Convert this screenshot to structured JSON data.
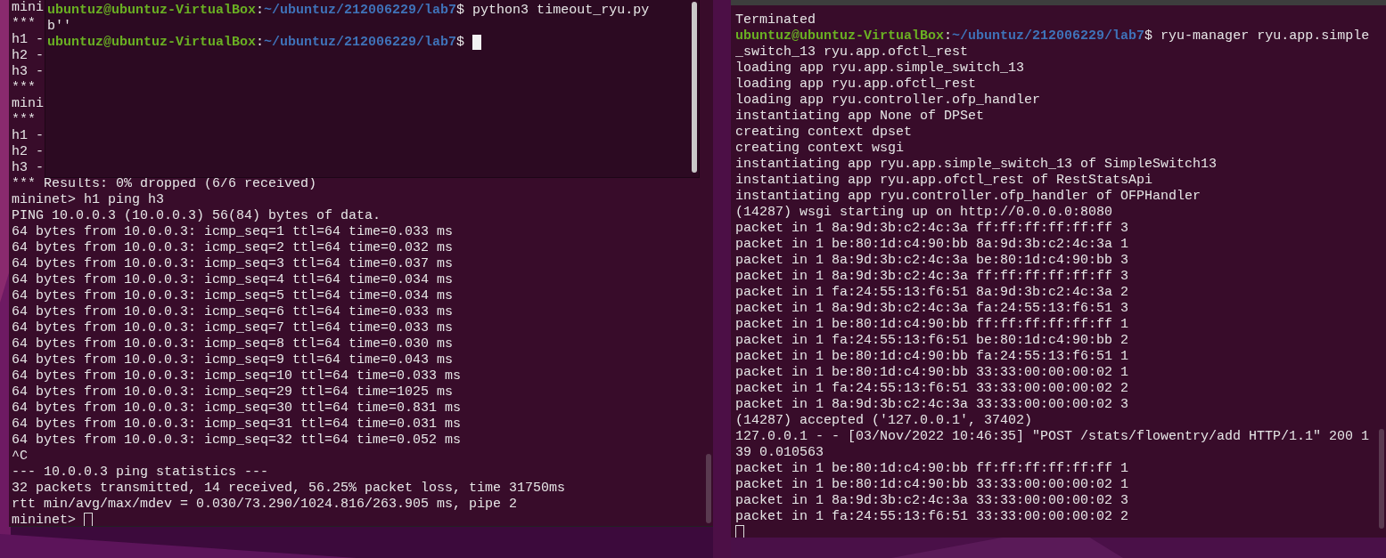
{
  "terminals": [
    {
      "lines": [
        {
          "kind": "output",
          "text": "mini"
        },
        {
          "kind": "output",
          "text": "***"
        },
        {
          "kind": "output",
          "text": "h1 -"
        },
        {
          "kind": "output",
          "text": "h2 -"
        },
        {
          "kind": "output",
          "text": "h3 -"
        },
        {
          "kind": "output",
          "text": "***"
        },
        {
          "kind": "output",
          "text": "mini"
        },
        {
          "kind": "output",
          "text": "***"
        },
        {
          "kind": "output",
          "text": "h1 -"
        },
        {
          "kind": "output",
          "text": "h2 -"
        },
        {
          "kind": "output",
          "text": "h3 -"
        },
        {
          "kind": "output",
          "text": "*** Results: 0% dropped (6/6 received)"
        },
        {
          "kind": "output",
          "text": "mininet> h1 ping h3"
        },
        {
          "kind": "output",
          "text": "PING 10.0.0.3 (10.0.0.3) 56(84) bytes of data."
        },
        {
          "kind": "output",
          "text": "64 bytes from 10.0.0.3: icmp_seq=1 ttl=64 time=0.033 ms"
        },
        {
          "kind": "output",
          "text": "64 bytes from 10.0.0.3: icmp_seq=2 ttl=64 time=0.032 ms"
        },
        {
          "kind": "output",
          "text": "64 bytes from 10.0.0.3: icmp_seq=3 ttl=64 time=0.037 ms"
        },
        {
          "kind": "output",
          "text": "64 bytes from 10.0.0.3: icmp_seq=4 ttl=64 time=0.034 ms"
        },
        {
          "kind": "output",
          "text": "64 bytes from 10.0.0.3: icmp_seq=5 ttl=64 time=0.034 ms"
        },
        {
          "kind": "output",
          "text": "64 bytes from 10.0.0.3: icmp_seq=6 ttl=64 time=0.033 ms"
        },
        {
          "kind": "output",
          "text": "64 bytes from 10.0.0.3: icmp_seq=7 ttl=64 time=0.033 ms"
        },
        {
          "kind": "output",
          "text": "64 bytes from 10.0.0.3: icmp_seq=8 ttl=64 time=0.030 ms"
        },
        {
          "kind": "output",
          "text": "64 bytes from 10.0.0.3: icmp_seq=9 ttl=64 time=0.043 ms"
        },
        {
          "kind": "output",
          "text": "64 bytes from 10.0.0.3: icmp_seq=10 ttl=64 time=0.033 ms"
        },
        {
          "kind": "output",
          "text": "64 bytes from 10.0.0.3: icmp_seq=29 ttl=64 time=1025 ms"
        },
        {
          "kind": "output",
          "text": "64 bytes from 10.0.0.3: icmp_seq=30 ttl=64 time=0.831 ms"
        },
        {
          "kind": "output",
          "text": "64 bytes from 10.0.0.3: icmp_seq=31 ttl=64 time=0.031 ms"
        },
        {
          "kind": "output",
          "text": "64 bytes from 10.0.0.3: icmp_seq=32 ttl=64 time=0.052 ms"
        },
        {
          "kind": "output",
          "text": "^C"
        },
        {
          "kind": "output",
          "text": "--- 10.0.0.3 ping statistics ---"
        },
        {
          "kind": "output",
          "text": "32 packets transmitted, 14 received, 56.25% packet loss, time 31750ms"
        },
        {
          "kind": "output",
          "text": "rtt min/avg/max/mdev = 0.030/73.290/1024.816/263.905 ms, pipe 2"
        },
        {
          "kind": "output",
          "text": "mininet> "
        }
      ],
      "cursor": {
        "focused": false,
        "own_line": false
      }
    },
    {
      "lines": [
        {
          "kind": "prompt",
          "user": "ubuntuz@ubuntuz-VirtualBox",
          "sep": ":",
          "path": "~/ubuntuz/212006229/lab7",
          "text": "$ python3 timeout_ryu.py"
        },
        {
          "kind": "output",
          "text": "b''"
        },
        {
          "kind": "prompt",
          "user": "ubuntuz@ubuntuz-VirtualBox",
          "sep": ":",
          "path": "~/ubuntuz/212006229/lab7",
          "text": "$ "
        }
      ],
      "cursor": {
        "focused": true,
        "own_line": false
      }
    },
    {
      "lines": [
        {
          "kind": "output",
          "text": "Terminated"
        },
        {
          "kind": "prompt",
          "user": "ubuntuz@ubuntuz-VirtualBox",
          "sep": ":",
          "path": "~/ubuntuz/212006229/lab7",
          "text": "$ ryu-manager ryu.app.simple"
        },
        {
          "kind": "output",
          "text": "_switch_13 ryu.app.ofctl_rest"
        },
        {
          "kind": "output",
          "text": "loading app ryu.app.simple_switch_13"
        },
        {
          "kind": "output",
          "text": "loading app ryu.app.ofctl_rest"
        },
        {
          "kind": "output",
          "text": "loading app ryu.controller.ofp_handler"
        },
        {
          "kind": "output",
          "text": "instantiating app None of DPSet"
        },
        {
          "kind": "output",
          "text": "creating context dpset"
        },
        {
          "kind": "output",
          "text": "creating context wsgi"
        },
        {
          "kind": "output",
          "text": "instantiating app ryu.app.simple_switch_13 of SimpleSwitch13"
        },
        {
          "kind": "output",
          "text": "instantiating app ryu.app.ofctl_rest of RestStatsApi"
        },
        {
          "kind": "output",
          "text": "instantiating app ryu.controller.ofp_handler of OFPHandler"
        },
        {
          "kind": "output",
          "text": "(14287) wsgi starting up on http://0.0.0.0:8080"
        },
        {
          "kind": "output",
          "text": "packet in 1 8a:9d:3b:c2:4c:3a ff:ff:ff:ff:ff:ff 3"
        },
        {
          "kind": "output",
          "text": "packet in 1 be:80:1d:c4:90:bb 8a:9d:3b:c2:4c:3a 1"
        },
        {
          "kind": "output",
          "text": "packet in 1 8a:9d:3b:c2:4c:3a be:80:1d:c4:90:bb 3"
        },
        {
          "kind": "output",
          "text": "packet in 1 8a:9d:3b:c2:4c:3a ff:ff:ff:ff:ff:ff 3"
        },
        {
          "kind": "output",
          "text": "packet in 1 fa:24:55:13:f6:51 8a:9d:3b:c2:4c:3a 2"
        },
        {
          "kind": "output",
          "text": "packet in 1 8a:9d:3b:c2:4c:3a fa:24:55:13:f6:51 3"
        },
        {
          "kind": "output",
          "text": "packet in 1 be:80:1d:c4:90:bb ff:ff:ff:ff:ff:ff 1"
        },
        {
          "kind": "output",
          "text": "packet in 1 fa:24:55:13:f6:51 be:80:1d:c4:90:bb 2"
        },
        {
          "kind": "output",
          "text": "packet in 1 be:80:1d:c4:90:bb fa:24:55:13:f6:51 1"
        },
        {
          "kind": "output",
          "text": "packet in 1 be:80:1d:c4:90:bb 33:33:00:00:00:02 1"
        },
        {
          "kind": "output",
          "text": "packet in 1 fa:24:55:13:f6:51 33:33:00:00:00:02 2"
        },
        {
          "kind": "output",
          "text": "packet in 1 8a:9d:3b:c2:4c:3a 33:33:00:00:00:02 3"
        },
        {
          "kind": "output",
          "text": "(14287) accepted ('127.0.0.1', 37402)"
        },
        {
          "kind": "output",
          "text": "127.0.0.1 - - [03/Nov/2022 10:46:35] \"POST /stats/flowentry/add HTTP/1.1\" 200 1"
        },
        {
          "kind": "output",
          "text": "39 0.010563"
        },
        {
          "kind": "output",
          "text": "packet in 1 be:80:1d:c4:90:bb ff:ff:ff:ff:ff:ff 1"
        },
        {
          "kind": "output",
          "text": "packet in 1 be:80:1d:c4:90:bb 33:33:00:00:00:02 1"
        },
        {
          "kind": "output",
          "text": "packet in 1 8a:9d:3b:c2:4c:3a 33:33:00:00:00:02 3"
        },
        {
          "kind": "output",
          "text": "packet in 1 fa:24:55:13:f6:51 33:33:00:00:00:02 2"
        }
      ],
      "cursor": {
        "focused": false,
        "own_line": true
      }
    }
  ]
}
